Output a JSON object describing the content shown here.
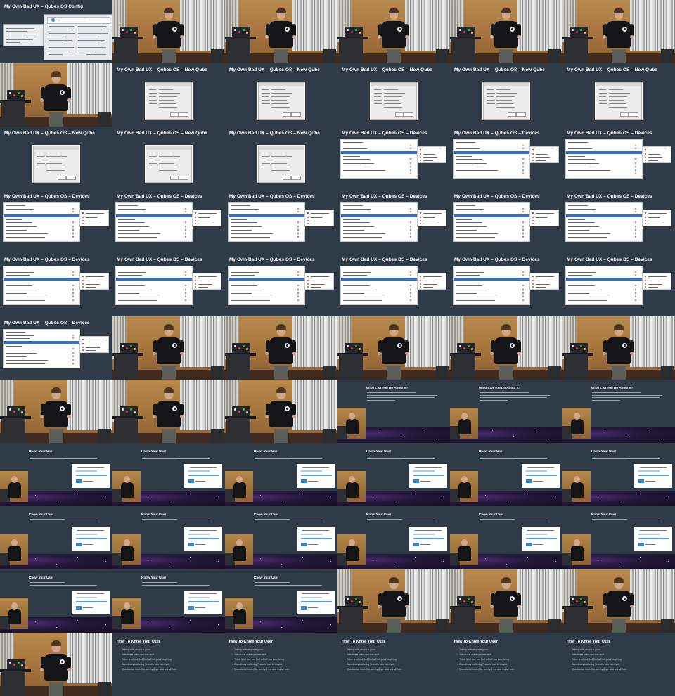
{
  "slide_titles": {
    "config": "My Own Bad UX – Qubes OS Config",
    "new_qube": "My Own Bad UX – Qubes OS – New Qube",
    "devices": "My Own Bad UX – Qubes OS – Devices"
  },
  "what_can_you_do": {
    "title": "What Can You Do About It?"
  },
  "know_your_user": {
    "title": "Know Your User"
  },
  "how_to_know": {
    "title": "How To Know Your User",
    "bullets": [
      "Talking with people is good",
      "Watch real users use real stuff",
      "There is no one tool that will tell you everything",
      "Sometimes bothering Pracwhe can be helpful",
      "Quantitative tools (like surveys) are also useful, but..."
    ]
  },
  "tiles": [
    "config",
    "video",
    "video",
    "video",
    "video",
    "video",
    "video",
    "newqube",
    "newqube",
    "newqube",
    "newqube",
    "newqube",
    "newqube",
    "newqube",
    "newqube",
    "devices",
    "devices",
    "devices",
    "devices",
    "devices",
    "devices",
    "devices",
    "devices",
    "devices",
    "devices",
    "devices",
    "devices",
    "devices",
    "devices",
    "devices",
    "devices",
    "video",
    "video",
    "video",
    "video",
    "video",
    "video",
    "video",
    "video",
    "whatcan",
    "whatcan",
    "whatcan",
    "know",
    "know",
    "know",
    "know",
    "know",
    "know",
    "know",
    "know",
    "know",
    "know",
    "know",
    "know",
    "know",
    "know",
    "know",
    "video",
    "video",
    "video",
    "video",
    "howto",
    "howto",
    "howto",
    "howto",
    "howto"
  ],
  "colors": {
    "slide_bg": "#2f3b46",
    "accent_blue": "#2e6fd1"
  }
}
